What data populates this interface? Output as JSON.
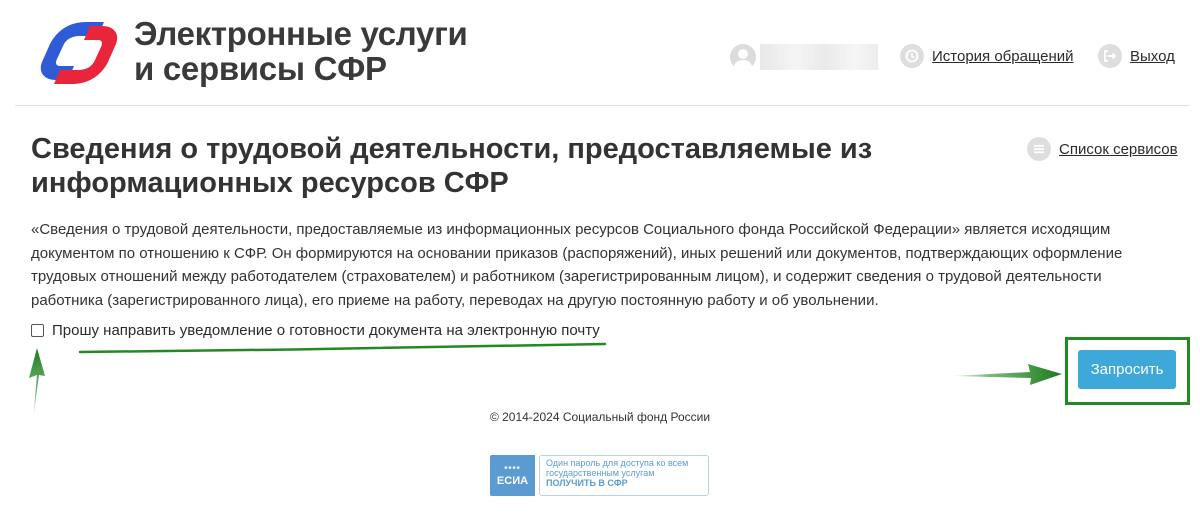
{
  "header": {
    "title_line1": "Электронные услуги",
    "title_line2": "и сервисы СФР",
    "username": "",
    "history_label": "История обращений",
    "logout_label": "Выход"
  },
  "main": {
    "title": "Сведения о трудовой деятельности, предоставляемые из информационных ресурсов СФР",
    "services_label": "Список сервисов",
    "description": "«Сведения о трудовой деятельности, предоставляемые из информационных ресурсов Социального фонда Российской Федерации» является исходящим документом по отношению к СФР. Он формируются на основании приказов (распоряжений), иных решений или документов, подтверждающих оформление трудовых отношений между работодателем (страхователем) и работником (зарегистрированным лицом), и содержит сведения о трудовой деятельности работника (зарегистрированного лица), его приеме на работу, переводах на другую постоянную работу и об увольнении.",
    "notify_label": "Прошу направить уведомление о готовности документа на электронную почту",
    "notify_checked": false,
    "submit_label": "Запросить"
  },
  "footer": {
    "copyright": "© 2014-2024 Социальный фонд России",
    "esia_stars": "****",
    "esia_badge": "ЕСИА",
    "esia_line1": "Один пароль для доступа ко всем",
    "esia_line2": "государственным услугам",
    "esia_line3": "ПОЛУЧИТЬ В СФР"
  },
  "colors": {
    "accent": "#3fa8db",
    "annotation": "#238a23",
    "logo_blue": "#2f5bd6",
    "logo_red": "#e8253b"
  },
  "icons": {
    "avatar": "user-avatar-icon",
    "history": "history-icon",
    "logout": "logout-icon",
    "services": "list-icon"
  }
}
